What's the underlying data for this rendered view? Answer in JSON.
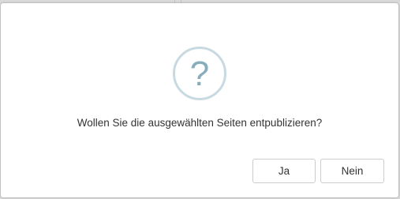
{
  "dialog": {
    "icon": "question-mark-icon",
    "icon_glyph": "?",
    "message": "Wollen Sie die ausgewählten Seiten entpublizieren?",
    "buttons": {
      "yes_label": "Ja",
      "no_label": "Nein"
    }
  },
  "colors": {
    "icon_ring": "#c8dae1",
    "icon_glyph": "#87adbd",
    "backdrop": "#d9d9d9"
  }
}
